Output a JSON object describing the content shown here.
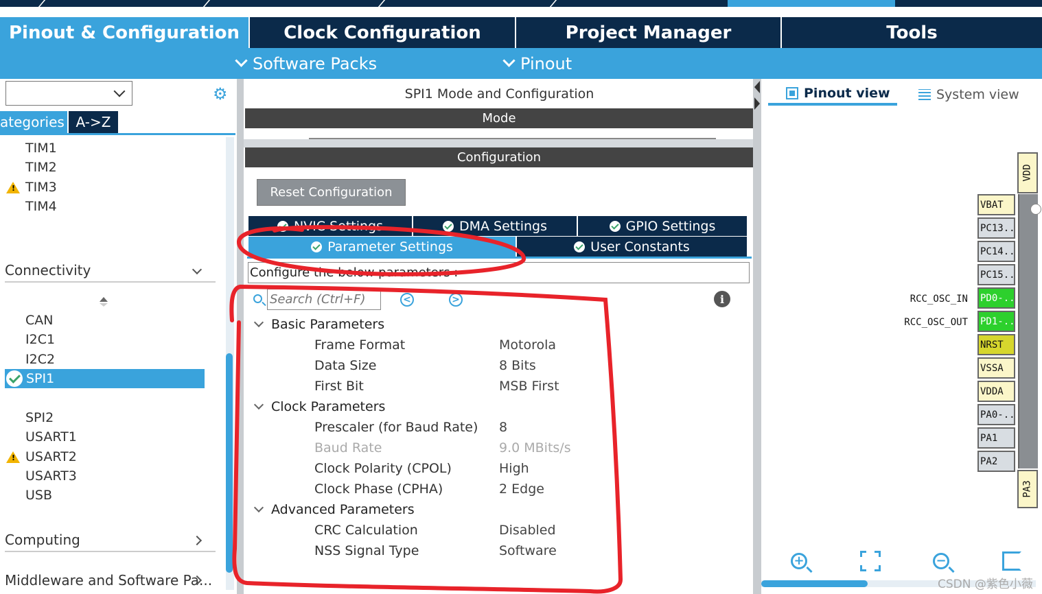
{
  "main_tabs": [
    "Pinout & Configuration",
    "Clock Configuration",
    "Project Manager",
    "Tools"
  ],
  "sub_menu": {
    "software_packs": "Software Packs",
    "pinout": "Pinout"
  },
  "left": {
    "category_tabs": [
      "ategories",
      "A->Z"
    ],
    "timers": [
      "TIM1",
      "TIM2",
      "TIM3",
      "TIM4"
    ],
    "connectivity_label": "Connectivity",
    "connectivity_items": [
      "CAN",
      "I2C1",
      "I2C2",
      "SPI1",
      "SPI2",
      "USART1",
      "USART2",
      "USART3",
      "USB"
    ],
    "computing_label": "Computing",
    "middleware_label": "Middleware and Software Pa..."
  },
  "middle": {
    "title": "SPI1 Mode and Configuration",
    "mode_label": "Mode",
    "configuration_label": "Configuration",
    "reset_button": "Reset Configuration",
    "tabs_row1": [
      "NVIC Settings",
      "DMA Settings",
      "GPIO Settings"
    ],
    "tabs_row2": [
      "Parameter Settings",
      "User Constants"
    ],
    "configure_text": "Configure the below parameters :",
    "search_placeholder": "Search (Ctrl+F)",
    "nav_prev": "<",
    "nav_next": ">",
    "info": "i",
    "groups": [
      {
        "name": "Basic Parameters",
        "params": [
          {
            "name": "Frame Format",
            "value": "Motorola"
          },
          {
            "name": "Data Size",
            "value": "8 Bits"
          },
          {
            "name": "First Bit",
            "value": "MSB First"
          }
        ]
      },
      {
        "name": "Clock Parameters",
        "params": [
          {
            "name": "Prescaler (for Baud Rate)",
            "value": "8"
          },
          {
            "name": "Baud Rate",
            "value": "9.0 MBits/s"
          },
          {
            "name": "Clock Polarity (CPOL)",
            "value": "High"
          },
          {
            "name": "Clock Phase (CPHA)",
            "value": "2 Edge"
          }
        ]
      },
      {
        "name": "Advanced Parameters",
        "params": [
          {
            "name": "CRC Calculation",
            "value": "Disabled"
          },
          {
            "name": "NSS Signal Type",
            "value": "Software"
          }
        ]
      }
    ]
  },
  "right": {
    "pinout_view": "Pinout view",
    "system_view": "System view",
    "pins": [
      "VBAT",
      "PC13..",
      "PC14..",
      "PC15..",
      "PD0-..",
      "PD1-..",
      "NRST",
      "VSSA",
      "VDDA",
      "PA0-..",
      "PA1",
      "PA2"
    ],
    "signal_labels": [
      "RCC_OSC_IN",
      "RCC_OSC_OUT"
    ],
    "top_pin": "VDD",
    "bottom_pin": "PA3",
    "watermark": "CSDN @紫色小薇"
  },
  "colors": {
    "accent": "#3aa3dc",
    "navy": "#0b2a4a",
    "annotation": "#e8232a"
  }
}
